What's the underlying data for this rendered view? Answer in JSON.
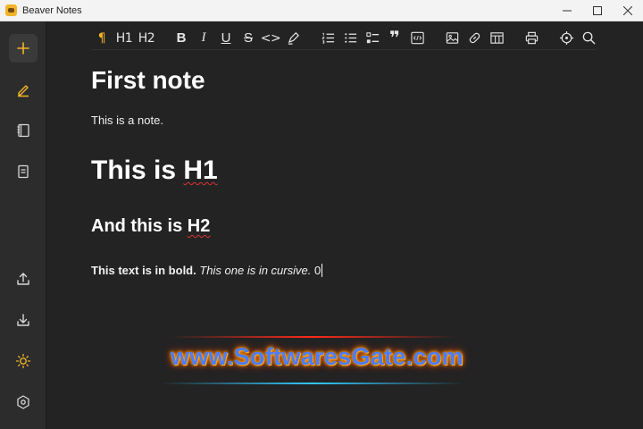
{
  "window": {
    "title": "Beaver Notes",
    "controls": [
      "minimize",
      "maximize",
      "close"
    ]
  },
  "sidebar": {
    "top_items": [
      {
        "icon": "plus-icon",
        "label": "New note"
      },
      {
        "icon": "pencil-icon",
        "label": "Notes",
        "active": true
      },
      {
        "icon": "notebook-icon",
        "label": "Archive"
      },
      {
        "icon": "document-icon",
        "label": "Labels"
      }
    ],
    "bottom_items": [
      {
        "icon": "upload-icon",
        "label": "Export"
      },
      {
        "icon": "download-icon",
        "label": "Import"
      },
      {
        "icon": "sun-icon",
        "label": "Theme"
      },
      {
        "icon": "settings-icon",
        "label": "Settings"
      }
    ]
  },
  "toolbar": {
    "paragraph_label": "¶",
    "h1_label": "H1",
    "h2_label": "H2",
    "bold_label": "B",
    "italic_label": "I",
    "underline_label": "U",
    "strike_label": "S",
    "code_label": "<>",
    "quote_label": "❞"
  },
  "document": {
    "title": "First note",
    "paragraph": "This is a note.",
    "heading1": "This is H1",
    "heading2_prefix": "And this is ",
    "heading2_spell": "H2",
    "heading1_prefix": "This is ",
    "heading1_spell": "H1",
    "bold_text": "This text is in bold.",
    "italic_text": "This one is in cursive.",
    "trailing_text": "0"
  },
  "watermark": {
    "text": "www.SoftwaresGate.com"
  },
  "colors": {
    "background": "#232323",
    "sidebar": "#2c2c2c",
    "accent": "#f0b429",
    "text": "#ffffff"
  }
}
